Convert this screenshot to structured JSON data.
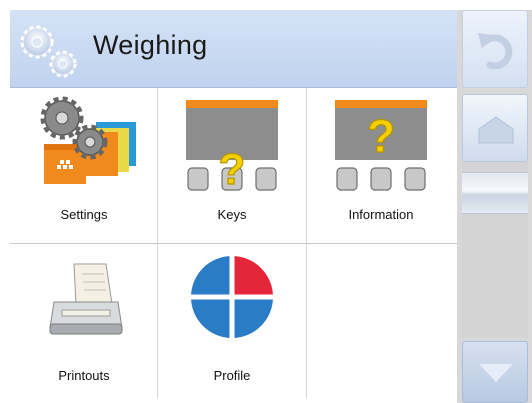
{
  "header": {
    "title": "Weighing",
    "icon": "gears-icon"
  },
  "tiles": [
    {
      "id": "settings",
      "label": "Settings",
      "icon": "settings-gears-icon"
    },
    {
      "id": "keys",
      "label": "Keys",
      "icon": "keys-help-icon"
    },
    {
      "id": "information",
      "label": "Information",
      "icon": "information-help-icon"
    },
    {
      "id": "printouts",
      "label": "Printouts",
      "icon": "printer-icon"
    },
    {
      "id": "profile",
      "label": "Profile",
      "icon": "profile-pie-icon"
    }
  ],
  "rightbar": {
    "buttons": [
      {
        "id": "back",
        "icon": "undo-arrow-icon"
      },
      {
        "id": "home",
        "icon": "home-icon"
      },
      {
        "id": "scrollbar",
        "icon": "scroll-thumb-icon"
      },
      {
        "id": "down",
        "icon": "down-arrow-icon"
      }
    ]
  },
  "colors": {
    "header_bg": "#c6d7f0",
    "accent_orange": "#f08a1c",
    "question_yellow": "#f4d000",
    "profile_red": "#e3263a",
    "profile_blue": "#2a7cc7"
  }
}
